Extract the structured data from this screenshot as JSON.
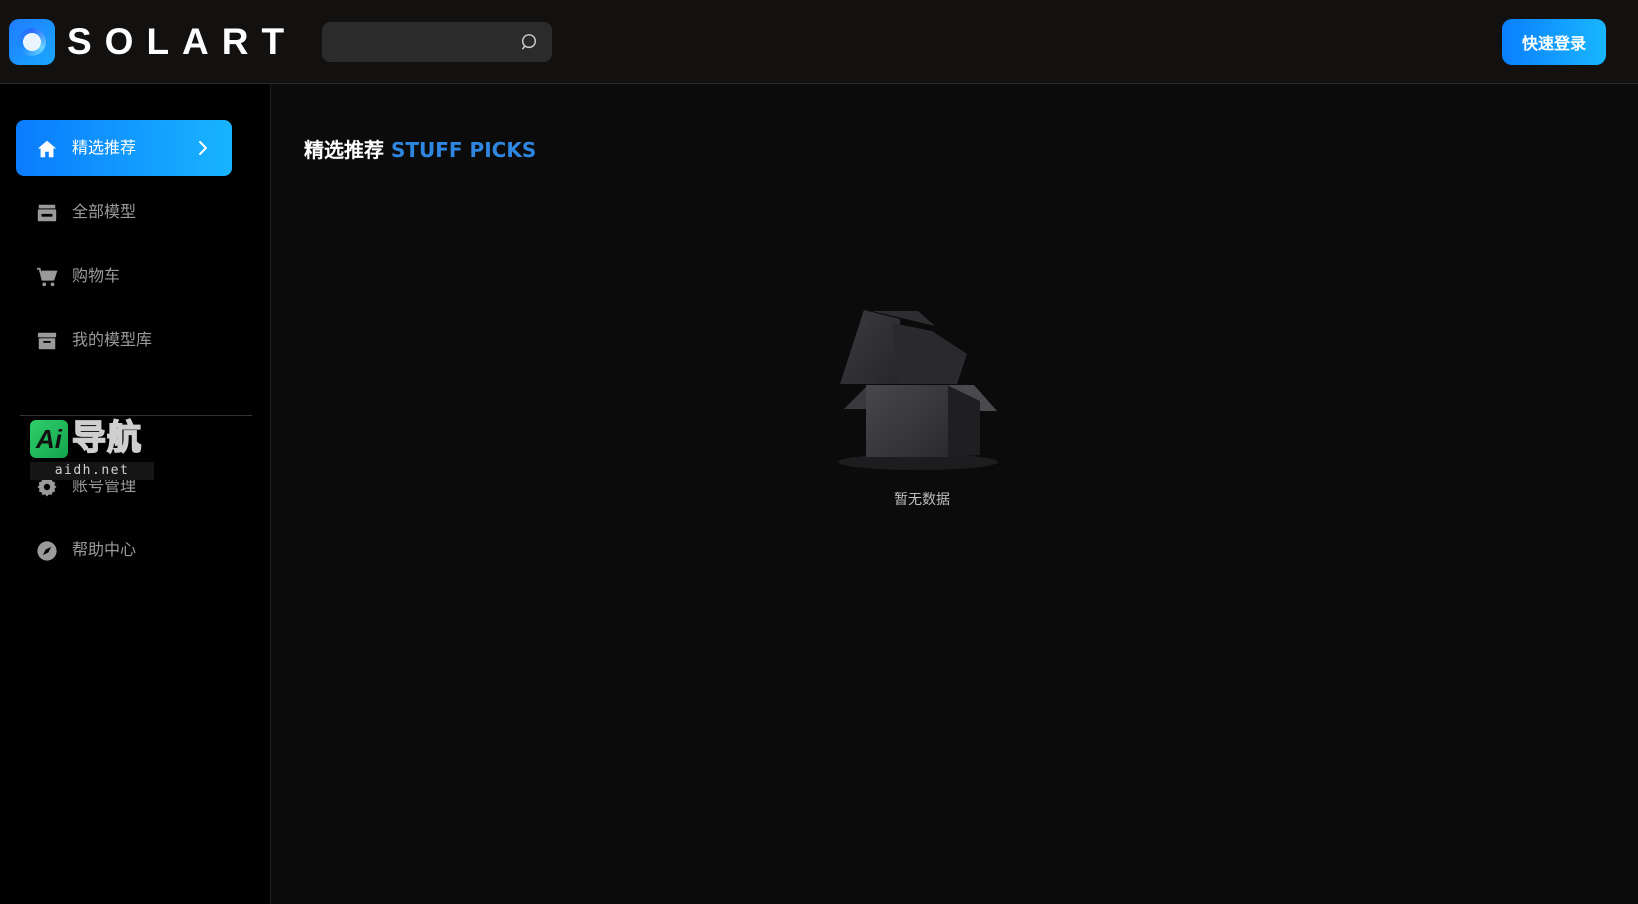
{
  "header": {
    "logo_text": "SOLART",
    "search": {
      "placeholder": "",
      "value": ""
    },
    "login_label": "快速登录",
    "accent_gradient": [
      "#0a7fff",
      "#19b6ff"
    ]
  },
  "sidebar": {
    "items": [
      {
        "label": "精选推荐",
        "icon": "home-icon",
        "active": true
      },
      {
        "label": "全部模型",
        "icon": "store-icon",
        "active": false
      },
      {
        "label": "购物车",
        "icon": "cart-icon",
        "active": false
      },
      {
        "label": "我的模型库",
        "icon": "archive-icon",
        "active": false
      },
      {
        "label": "账号管理",
        "icon": "gear-icon",
        "active": false
      },
      {
        "label": "帮助中心",
        "icon": "compass-icon",
        "active": false
      }
    ]
  },
  "watermark": {
    "badge": "Ai",
    "title": "导航",
    "url": "aidh.net"
  },
  "main": {
    "title_cn": "精选推荐",
    "title_en": "STUFF PICKS",
    "empty_text": "暂无数据"
  }
}
